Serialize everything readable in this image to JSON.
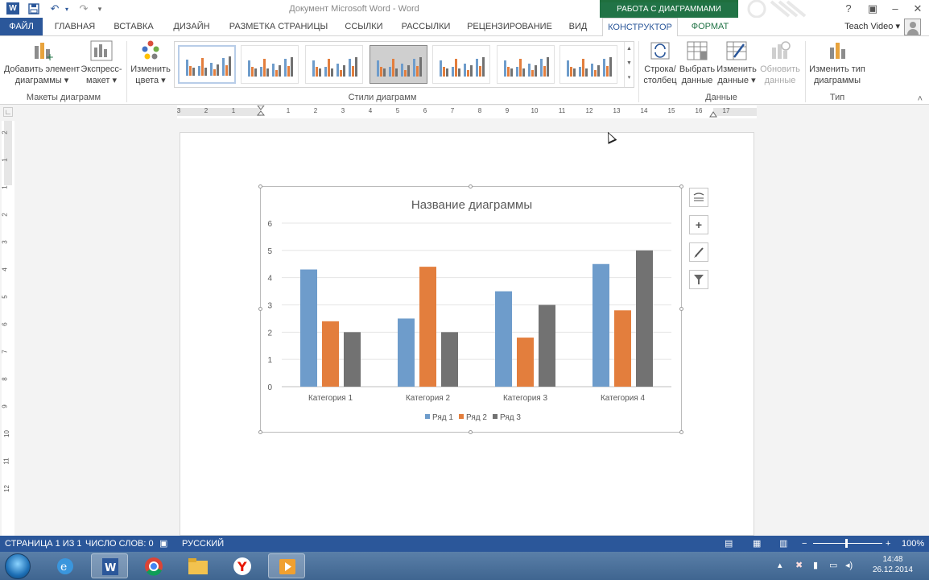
{
  "titlebar": {
    "doc_title": "Документ Microsoft Word - Word",
    "context_group": "РАБОТА С ДИАГРАММАМИ",
    "help": "?"
  },
  "tabs": [
    {
      "label": "ФАЙЛ"
    },
    {
      "label": "ГЛАВНАЯ"
    },
    {
      "label": "ВСТАВКА"
    },
    {
      "label": "ДИЗАЙН"
    },
    {
      "label": "РАЗМЕТКА СТРАНИЦЫ"
    },
    {
      "label": "ССЫЛКИ"
    },
    {
      "label": "РАССЫЛКИ"
    },
    {
      "label": "РЕЦЕНЗИРОВАНИЕ"
    },
    {
      "label": "ВИД"
    },
    {
      "label": "КОНСТРУКТОР"
    },
    {
      "label": "ФОРМАТ"
    }
  ],
  "user": {
    "name": "Teach Video"
  },
  "ribbon": {
    "add_element": {
      "line1": "Добавить элемент",
      "line2": "диаграммы ▾"
    },
    "express_layout": {
      "line1": "Экспресс-",
      "line2": "макет ▾"
    },
    "change_colors": {
      "line1": "Изменить",
      "line2": "цвета ▾"
    },
    "row_column": {
      "line1": "Строка/",
      "line2": "столбец"
    },
    "select_data": {
      "line1": "Выбрать",
      "line2": "данные"
    },
    "edit_data": {
      "line1": "Изменить",
      "line2": "данные ▾"
    },
    "refresh_data": {
      "line1": "Обновить",
      "line2": "данные"
    },
    "change_type": {
      "line1": "Изменить тип",
      "line2": "диаграммы"
    },
    "groups": {
      "layouts": "Макеты диаграмм",
      "styles": "Стили диаграмм",
      "data": "Данные",
      "type": "Тип"
    }
  },
  "ruler": {
    "h_ticks": [
      "3",
      "2",
      "1",
      "1",
      "2",
      "3",
      "4",
      "5",
      "6",
      "7",
      "8",
      "9",
      "10",
      "11",
      "12",
      "13",
      "14",
      "15",
      "16",
      "17"
    ],
    "v_ticks": [
      "2",
      "1",
      "1",
      "2",
      "3",
      "4",
      "5",
      "6",
      "7",
      "8",
      "9",
      "10",
      "11",
      "12"
    ]
  },
  "chart_data": {
    "type": "bar",
    "title": "Название диаграммы",
    "categories": [
      "Категория 1",
      "Категория 2",
      "Категория 3",
      "Категория 4"
    ],
    "series": [
      {
        "name": "Ряд 1",
        "values": [
          4.3,
          2.5,
          3.5,
          4.5
        ],
        "color": "#6e9ccb"
      },
      {
        "name": "Ряд 2",
        "values": [
          2.4,
          4.4,
          1.8,
          2.8
        ],
        "color": "#e37e3d"
      },
      {
        "name": "Ряд 3",
        "values": [
          2.0,
          2.0,
          3.0,
          5.0
        ],
        "color": "#727272"
      }
    ],
    "ylim": [
      0,
      6
    ],
    "yticks": [
      "0",
      "1",
      "2",
      "3",
      "4",
      "5",
      "6"
    ],
    "grid": true,
    "legend": "bottom"
  },
  "statusbar": {
    "page": "СТРАНИЦА 1 ИЗ 1",
    "words": "ЧИСЛО СЛОВ: 0",
    "language": "РУССКИЙ",
    "zoom": "100%",
    "zoom_minus": "−",
    "zoom_plus": "+"
  },
  "taskbar": {
    "time": "14:48",
    "date": "26.12.2014"
  },
  "colors": {
    "word_blue": "#2b579a",
    "context_green": "#217346"
  }
}
